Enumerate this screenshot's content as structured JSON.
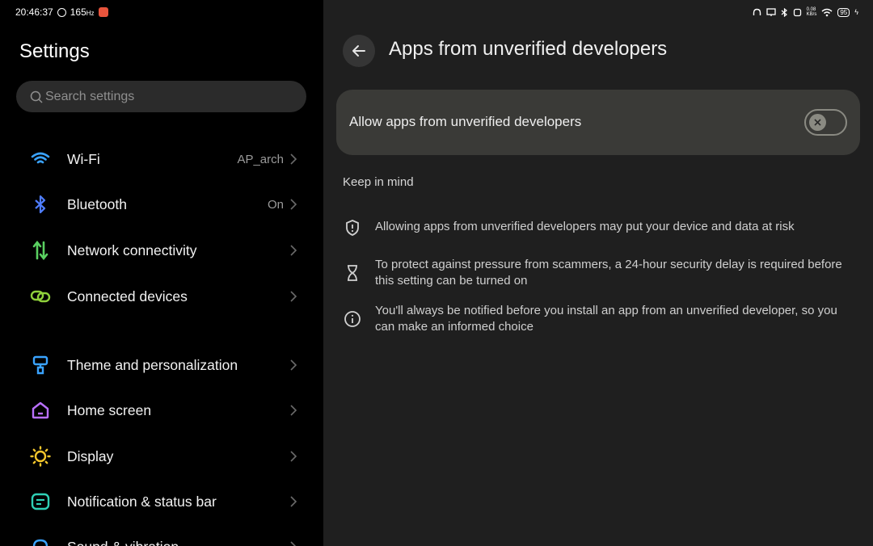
{
  "status_left": {
    "time": "20:46:37",
    "refresh": "165"
  },
  "status_right": {
    "net_speed": "0.08\nKB/s",
    "battery": "95"
  },
  "left": {
    "title": "Settings",
    "search_placeholder": "Search settings",
    "items": [
      {
        "label": "Wi-Fi",
        "value": "AP_arch",
        "icon": "wifi-icon",
        "color": "#3aa3ff"
      },
      {
        "label": "Bluetooth",
        "value": "On",
        "icon": "bluetooth-icon",
        "color": "#4f7dff"
      },
      {
        "label": "Network connectivity",
        "value": "",
        "icon": "network-arrows-icon",
        "color": "#5ad061"
      },
      {
        "label": "Connected devices",
        "value": "",
        "icon": "chain-link-icon",
        "color": "#8fd13b"
      },
      {
        "label": "Theme and personalization",
        "value": "",
        "icon": "paint-roller-icon",
        "color": "#3aa3ff"
      },
      {
        "label": "Home screen",
        "value": "",
        "icon": "home-icon",
        "color": "#b970ff"
      },
      {
        "label": "Display",
        "value": "",
        "icon": "sun-icon",
        "color": "#f5c72c"
      },
      {
        "label": "Notification & status bar",
        "value": "",
        "icon": "notification-icon",
        "color": "#2fd0b6"
      },
      {
        "label": "Sound & vibration",
        "value": "",
        "icon": "sound-icon",
        "color": "#3aa3ff"
      }
    ]
  },
  "right": {
    "title": "Apps from unverified developers",
    "toggle_label": "Allow apps from unverified developers",
    "toggle_on": false,
    "section_title": "Keep in mind",
    "tips": [
      {
        "icon": "shield-alert-icon",
        "text": "Allowing apps from unverified developers may put your device and data at risk"
      },
      {
        "icon": "hourglass-icon",
        "text": "To protect against pressure from scammers, a 24-hour security delay is required before this setting can be turned on"
      },
      {
        "icon": "info-icon",
        "text": "You'll always be notified before you install an app from an unverified developer, so you can make an informed choice"
      }
    ]
  }
}
